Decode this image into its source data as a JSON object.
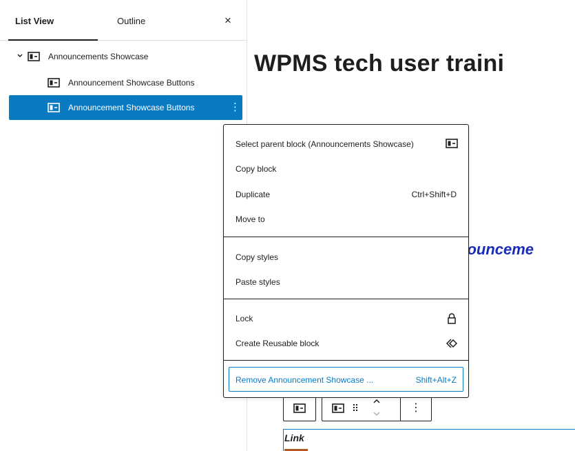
{
  "sidebar": {
    "tabs": [
      {
        "label": "List View",
        "active": true
      },
      {
        "label": "Outline",
        "active": false
      }
    ],
    "close_glyph": "×",
    "tree": [
      {
        "label": "Announcements Showcase",
        "icon": "group-block-icon",
        "expanded": true
      },
      {
        "label": "Announcement Showcase Buttons",
        "icon": "group-block-icon"
      },
      {
        "label": "Announcement Showcase Buttons",
        "icon": "group-block-icon",
        "selected": true,
        "options_glyph": "⋮"
      }
    ]
  },
  "content": {
    "heading": "WPMS tech user traini",
    "sub_heading": "nounceme",
    "link_text": "Link",
    "toolbar": {
      "drag_glyph": "⠿",
      "more_glyph": "⋮"
    }
  },
  "context_menu": {
    "sections": [
      {
        "items": [
          {
            "label": "Select parent block (Announcements Showcase)",
            "icon": "group-block-icon"
          },
          {
            "label": "Copy block"
          },
          {
            "label": "Duplicate",
            "shortcut": "Ctrl+Shift+D"
          },
          {
            "label": "Move to"
          }
        ]
      },
      {
        "items": [
          {
            "label": "Copy styles"
          },
          {
            "label": "Paste styles"
          }
        ]
      },
      {
        "items": [
          {
            "label": "Lock",
            "icon": "lock-icon"
          },
          {
            "label": "Create Reusable block",
            "icon": "reusable-block-icon"
          }
        ]
      },
      {
        "items": [
          {
            "label": "Remove Announcement Showcase ...",
            "shortcut": "Shift+Alt+Z"
          }
        ]
      }
    ]
  },
  "colors": {
    "accent": "#0a7bc2",
    "text": "#1e1e1e",
    "sub_heading": "#1a2bb8",
    "border": "#e0e0e0"
  }
}
